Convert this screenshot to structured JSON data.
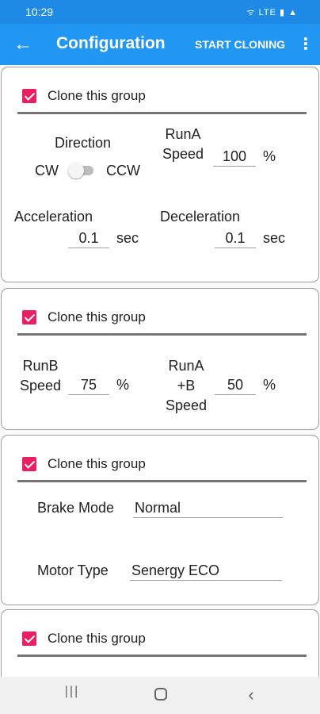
{
  "status_bar": {
    "time": "10:29",
    "icons": "ᯤ LTE ▮ ▲"
  },
  "app_bar": {
    "title": "Configuration",
    "start_button": "START CLONING"
  },
  "groups": [
    {
      "checkbox_label": "Clone this group",
      "checked": true,
      "direction": {
        "label": "Direction",
        "left": "CW",
        "right": "CCW",
        "value": "CW"
      },
      "runa_speed": {
        "label": "RunA Speed",
        "value": "100",
        "unit": "%"
      },
      "acceleration": {
        "label": "Acceleration",
        "value": "0.1",
        "unit": "sec"
      },
      "deceleration": {
        "label": "Deceleration",
        "value": "0.1",
        "unit": "sec"
      }
    },
    {
      "checkbox_label": "Clone this group",
      "checked": true,
      "runb_speed": {
        "label": "RunB Speed",
        "value": "75",
        "unit": "%"
      },
      "runab_speed": {
        "label": "RunA +B Speed",
        "value": "50",
        "unit": "%"
      }
    },
    {
      "checkbox_label": "Clone this group",
      "checked": true,
      "brake_mode": {
        "label": "Brake Mode",
        "value": "Normal"
      },
      "motor_type": {
        "label": "Motor Type",
        "value": "Senergy ECO"
      }
    },
    {
      "checkbox_label": "Clone this group",
      "checked": true
    }
  ],
  "colors": {
    "status_bar": "#1f8ae6",
    "app_bar": "#2196f3",
    "checkbox": "#e91e63"
  },
  "icons": {
    "back": "arrow-left-icon",
    "overflow": "more-vert-icon",
    "recents": "recents-icon",
    "home": "home-icon",
    "nav_back": "chevron-left-icon"
  }
}
